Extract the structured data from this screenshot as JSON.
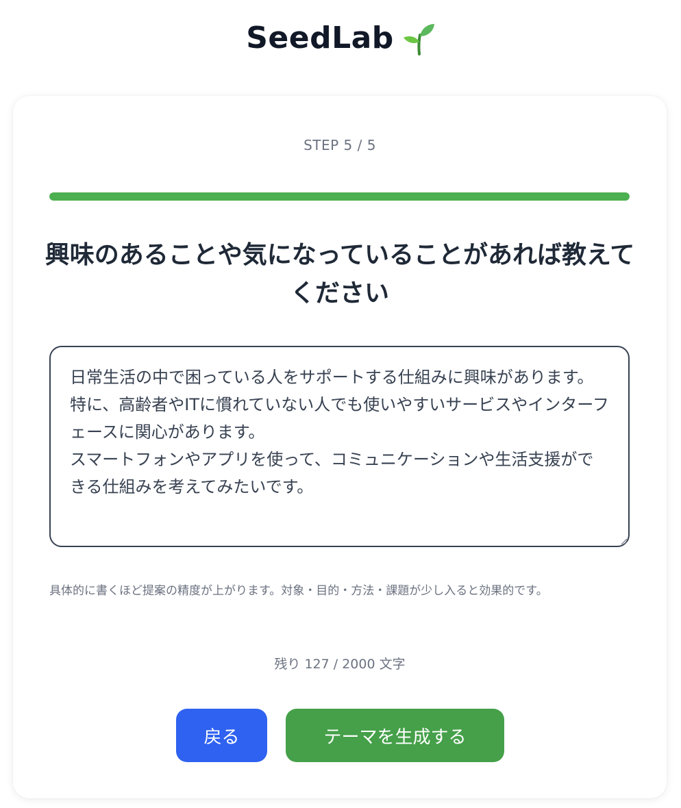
{
  "header": {
    "logo_text": "SeedLab",
    "logo_icon": "seedling-icon"
  },
  "wizard": {
    "step_label": "STEP 5 / 5",
    "progress_percent": 100,
    "progress_color": "#4caf50",
    "question": "興味のあることや気になっていることがあれば教えてください",
    "answer_value": "日常生活の中で困っている人をサポートする仕組みに興味があります。\n特に、高齢者やITに慣れていない人でも使いやすいサービスやインターフェースに関心があります。\nスマートフォンやアプリを使って、コミュニケーションや生活支援ができる仕組みを考えてみたいです。",
    "hint": "具体的に書くほど提案の精度が上がります。対象・目的・方法・課題が少し入ると効果的です。",
    "counter": "残り 127 / 2000 文字"
  },
  "actions": {
    "back_label": "戻る",
    "back_color": "#2f62f0",
    "generate_label": "テーマを生成する",
    "generate_color": "#45a049"
  }
}
